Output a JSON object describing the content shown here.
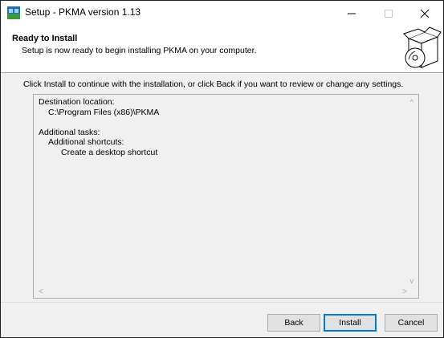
{
  "window": {
    "title": "Setup - PKMA version 1.13",
    "controls": {
      "minimize": "—",
      "maximize": "□",
      "close": "✕"
    }
  },
  "header": {
    "title": "Ready to Install",
    "subtitle": "Setup is now ready to begin installing PKMA on your computer.",
    "image_icon": "install-box-icon"
  },
  "body": {
    "instruction": "Click Install to continue with the installation, or click Back if you want to review or change any settings.",
    "memo": {
      "destination_label": "Destination location:",
      "destination_value": "C:\\Program Files (x86)\\PKMA",
      "tasks_label": "Additional tasks:",
      "shortcuts_label": "Additional shortcuts:",
      "shortcut_item": "Create a desktop shortcut"
    },
    "scroll": {
      "up": "^",
      "down": "v",
      "left": "<",
      "right": ">"
    }
  },
  "buttons": {
    "back": "Back",
    "install": "Install",
    "cancel": "Cancel"
  },
  "colors": {
    "accent": "#0078d7",
    "panel": "#f0f0f0",
    "button": "#e1e1e1"
  }
}
